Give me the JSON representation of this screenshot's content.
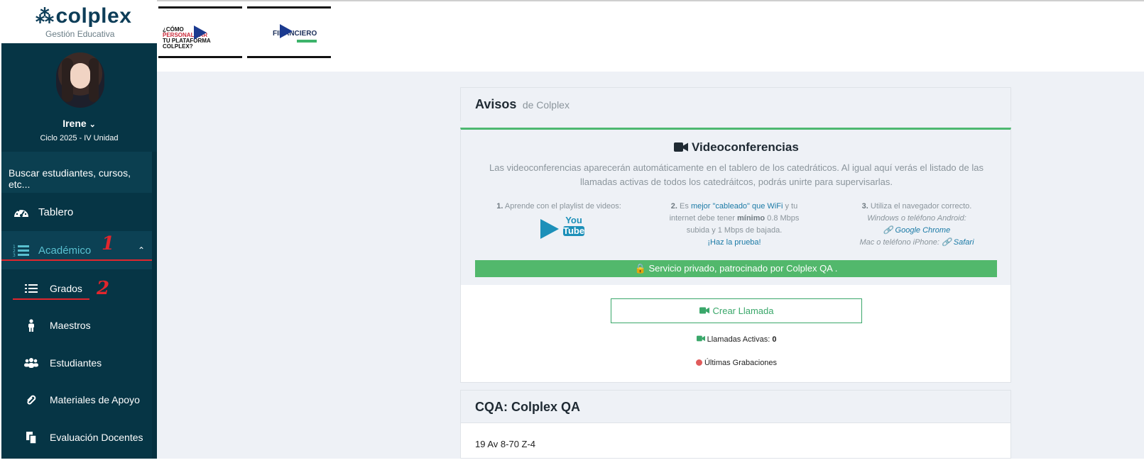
{
  "app": {
    "logo": "colplex",
    "logo_sub": "Gestión Educativa"
  },
  "user": {
    "name": "Irene",
    "cycle": "Ciclo 2025 - IV Unidad"
  },
  "sidebar": {
    "search_placeholder": "Buscar estudiantes, cursos, etc...",
    "items": [
      {
        "label": "Tablero",
        "icon": "dashboard-icon"
      },
      {
        "label": "Académico",
        "icon": "list-ordered-icon",
        "active": true
      }
    ],
    "sub_items": [
      {
        "label": "Grados",
        "icon": "list-icon"
      },
      {
        "label": "Maestros",
        "icon": "person-icon"
      },
      {
        "label": "Estudiantes",
        "icon": "users-icon"
      },
      {
        "label": "Materiales de Apoyo",
        "icon": "paperclip-icon"
      },
      {
        "label": "Evaluación Docentes",
        "icon": "copy-icon"
      }
    ]
  },
  "annotations": {
    "one": "1",
    "two": "2"
  },
  "banners": {
    "b1_line1": "¿CÓMO",
    "b1_line2": "PERSONALIZAR",
    "b1_line3": "TU PLATAFORMA",
    "b1_line4": "COLPLEX?",
    "b2_text": "FINANCIERO"
  },
  "avisos": {
    "title": "Avisos",
    "subtitle": "de Colplex"
  },
  "video": {
    "title": "Videoconferencias",
    "description": "Las videoconferencias aparecerán automáticamente en el tablero de los catedráticos. Al igual aquí verás el listado de las llamadas activas de todos los catedráitcos, podrás unirte para supervisarlas.",
    "col1_num": "1.",
    "col1_text": "Aprende con el playlist de videos:",
    "youtube_label_1": "You",
    "youtube_label_2": "Tube",
    "col2_num": "2.",
    "col2_text_a": "Es",
    "col2_link": "mejor \"cableado\" que WiFi",
    "col2_text_b": "y tu internet debe tener",
    "col2_bold": "mínimo",
    "col2_text_c": "0.8 Mbps subida y 1 Mbps de bajada.",
    "col2_test": "¡Haz la prueba!",
    "col3_num": "3.",
    "col3_text": "Utiliza el navegador correcto.",
    "col3_win": "Windows o teléfono Android:",
    "col3_chrome": "Google Chrome",
    "col3_mac": "Mac o teléfono iPhone:",
    "col3_safari": "Safari",
    "private": "Servicio privado, patrocinado por Colplex QA ."
  },
  "calls": {
    "create_label": "Crear Llamada",
    "active_label": "Llamadas Activas:",
    "active_count": "0",
    "recordings_label": "Últimas Grabaciones"
  },
  "school": {
    "title": "CQA: Colplex QA",
    "address": "19 Av 8-70 Z-4"
  }
}
